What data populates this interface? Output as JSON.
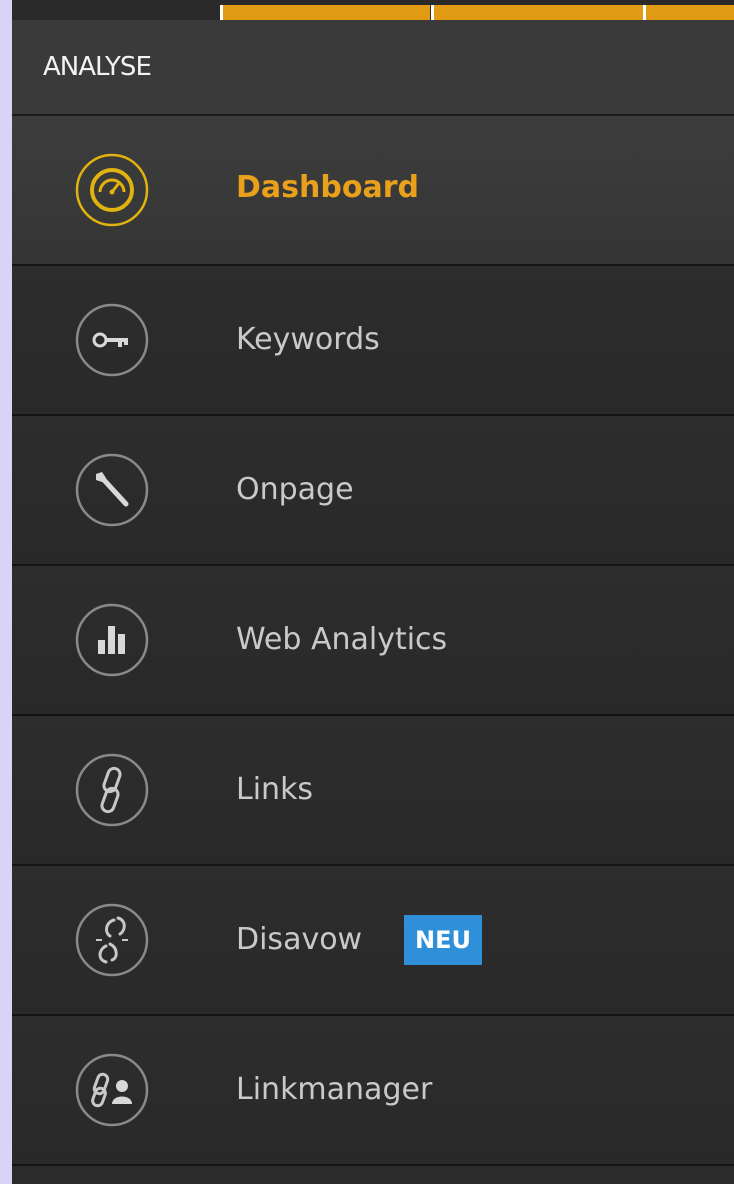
{
  "section": {
    "title": "ANALYSE"
  },
  "progress": {
    "segments": 3,
    "active": 3
  },
  "colors": {
    "accent": "#e9a11c",
    "badge": "#2f8fd8",
    "background": "#2b2b2b",
    "header": "#3a3a3a",
    "icon_stroke": "#8a8a8a"
  },
  "nav": {
    "items": [
      {
        "label": "Dashboard",
        "icon": "speedometer-icon",
        "active": true
      },
      {
        "label": "Keywords",
        "icon": "key-icon",
        "active": false
      },
      {
        "label": "Onpage",
        "icon": "wrench-icon",
        "active": false
      },
      {
        "label": "Web Analytics",
        "icon": "bar-chart-icon",
        "active": false
      },
      {
        "label": "Links",
        "icon": "link-icon",
        "active": false
      },
      {
        "label": "Disavow",
        "icon": "broken-link-icon",
        "active": false,
        "badge": "NEU"
      },
      {
        "label": "Linkmanager",
        "icon": "link-user-icon",
        "active": false
      }
    ]
  }
}
